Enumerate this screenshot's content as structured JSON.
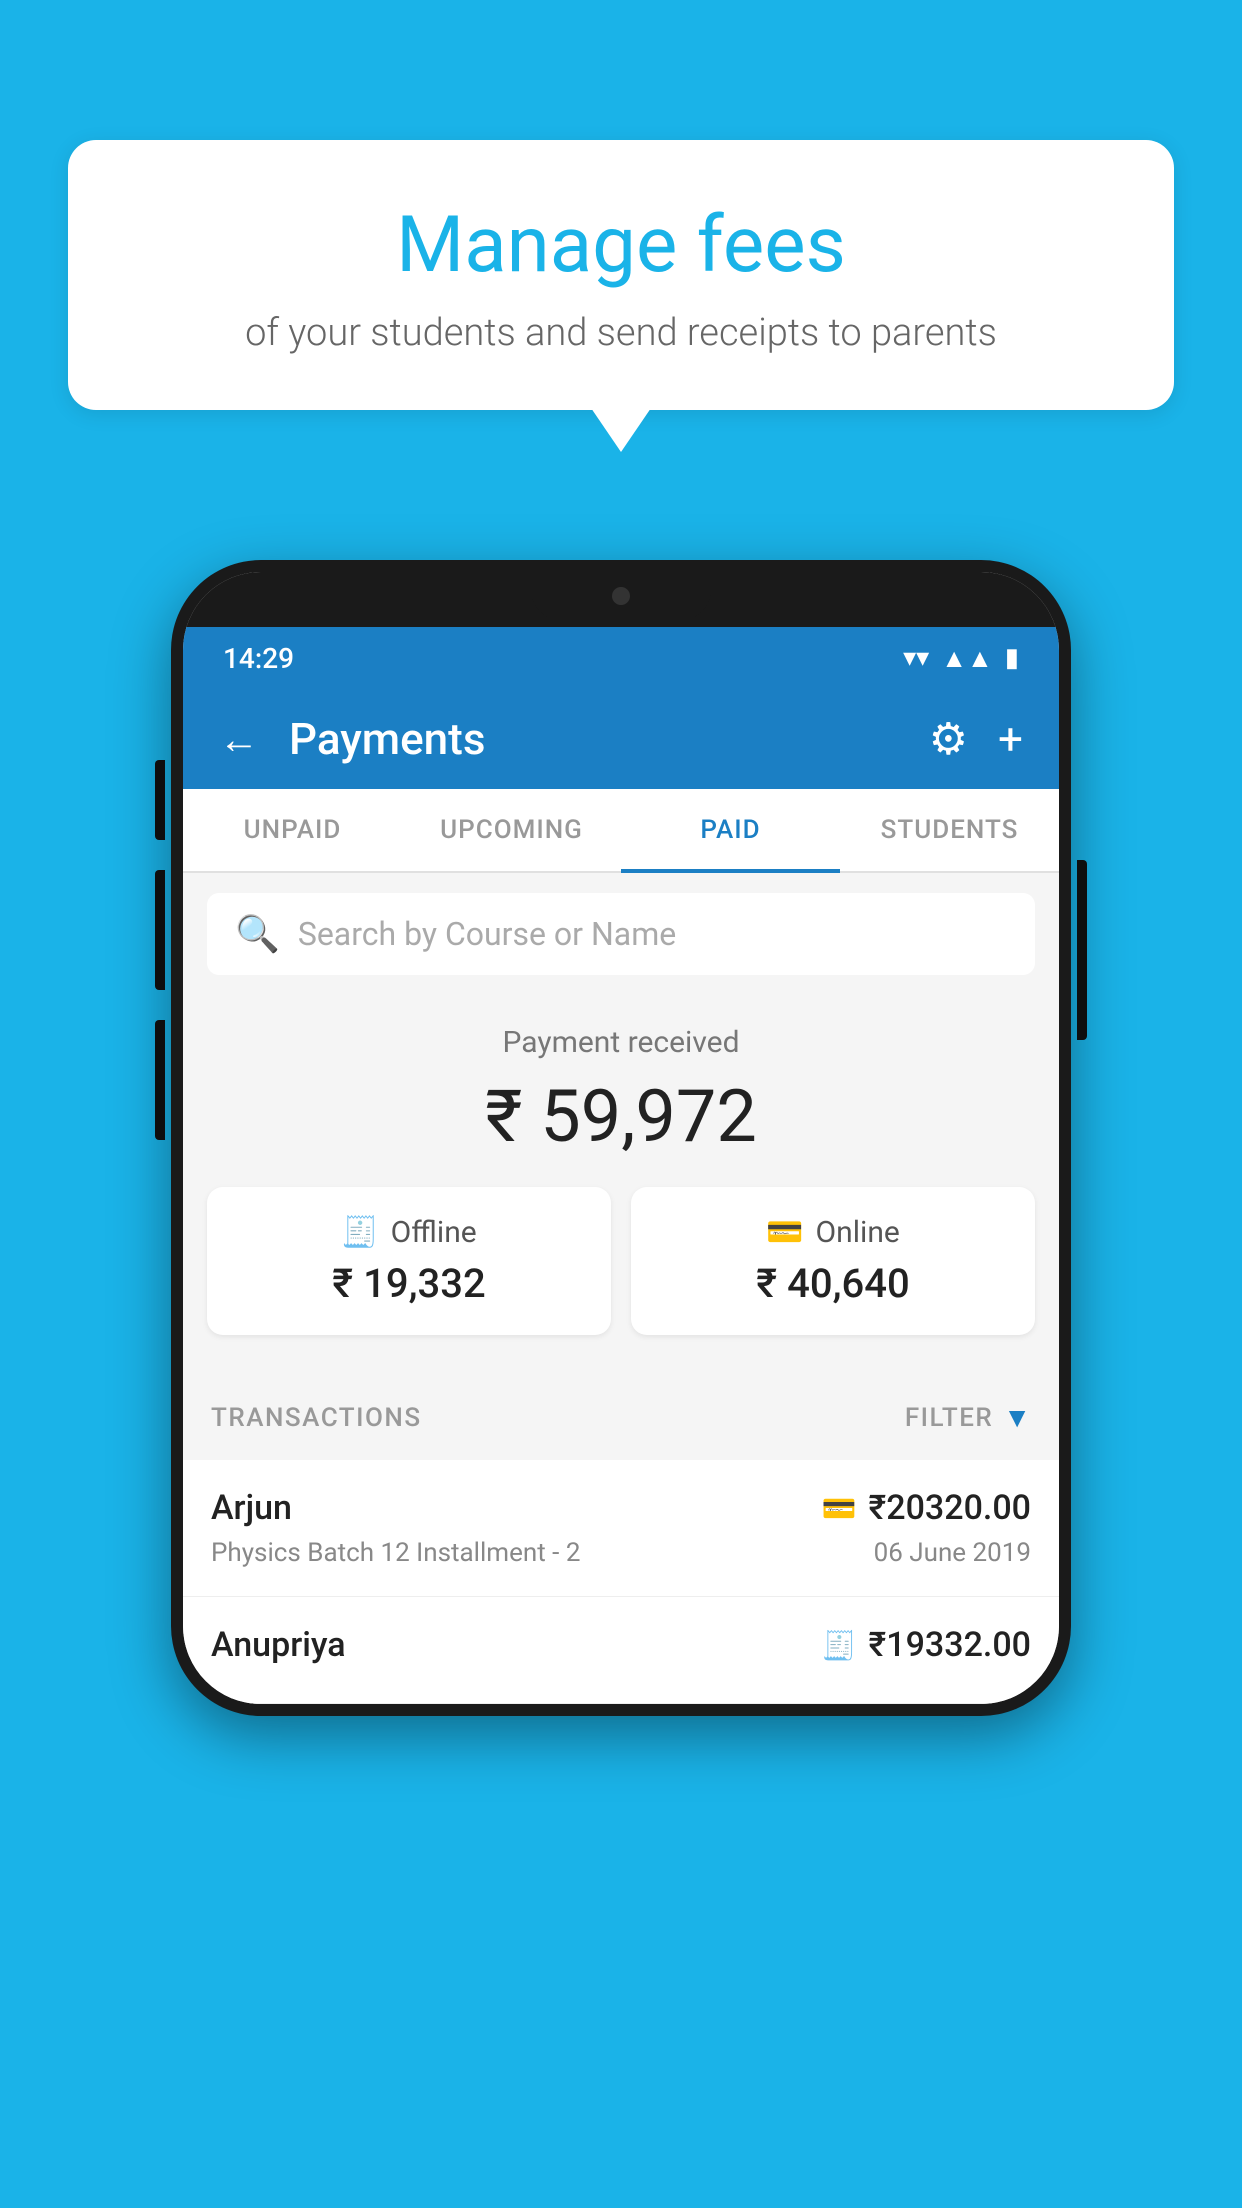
{
  "background_color": "#1ab3e8",
  "speech_bubble": {
    "title": "Manage fees",
    "subtitle": "of your students and send receipts to parents"
  },
  "status_bar": {
    "time": "14:29",
    "wifi": "▼",
    "signal": "▲",
    "battery": "▮"
  },
  "app_bar": {
    "title": "Payments",
    "back_label": "←",
    "gear_label": "⚙",
    "plus_label": "+"
  },
  "tabs": [
    {
      "label": "UNPAID",
      "active": false
    },
    {
      "label": "UPCOMING",
      "active": false
    },
    {
      "label": "PAID",
      "active": true
    },
    {
      "label": "STUDENTS",
      "active": false
    }
  ],
  "search": {
    "placeholder": "Search by Course or Name"
  },
  "payment_summary": {
    "label": "Payment received",
    "total": "₹ 59,972",
    "offline": {
      "label": "Offline",
      "amount": "₹ 19,332"
    },
    "online": {
      "label": "Online",
      "amount": "₹ 40,640"
    }
  },
  "transactions_section": {
    "label": "TRANSACTIONS",
    "filter_label": "FILTER"
  },
  "transactions": [
    {
      "name": "Arjun",
      "detail": "Physics Batch 12 Installment - 2",
      "amount": "₹20320.00",
      "date": "06 June 2019",
      "payment_type": "online"
    },
    {
      "name": "Anupriya",
      "detail": "",
      "amount": "₹19332.00",
      "date": "",
      "payment_type": "offline"
    }
  ]
}
